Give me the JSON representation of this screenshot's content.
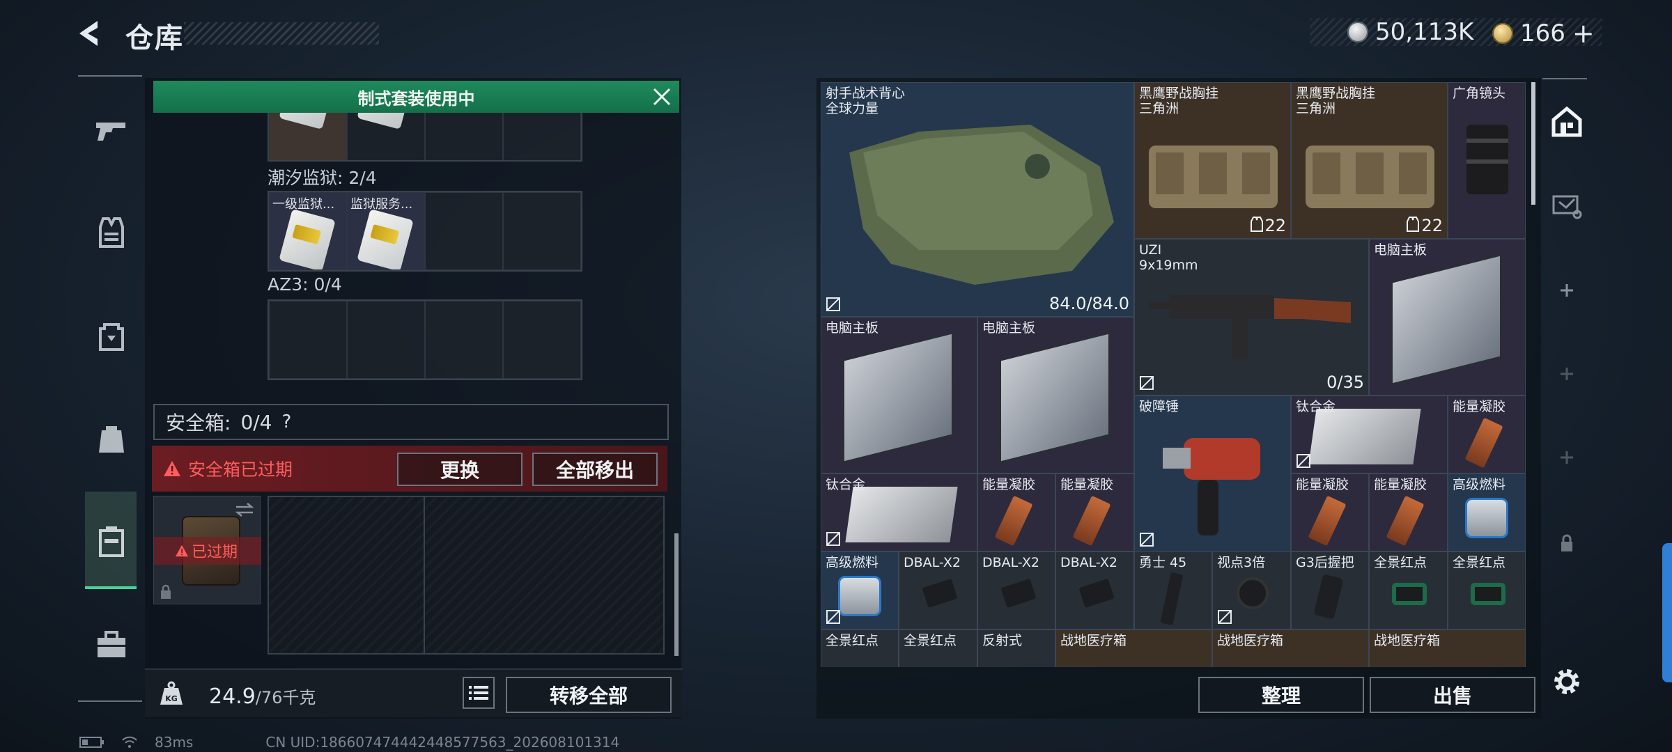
{
  "header": {
    "title": "仓库",
    "currency1": "50,113K",
    "currency2": "166",
    "currency2_add": "+"
  },
  "left_panel": {
    "banner": "制式套装使用中",
    "section1_label": "潮汐监狱: 2/4",
    "section1_slot1": "一级监狱...",
    "section1_slot2": "监狱服务...",
    "section2_label": "AZ3: 0/4",
    "safebox_label": "安全箱:",
    "safebox_count": "0/4",
    "safebox_help": "?",
    "alert_text": "安全箱已过期",
    "replace_button": "更换",
    "remove_all_button": "全部移出",
    "expired_text": "已过期",
    "weight_current": "24.9",
    "weight_max": "/76千克",
    "transfer_all_button": "转移全部"
  },
  "storage": {
    "items": [
      {
        "name": "射手战术背心\n全球力量",
        "value": "84.0/84.0"
      },
      {
        "name": "黑鹰野战胸挂\n三角洲",
        "value": "22"
      },
      {
        "name": "黑鹰野战胸挂\n三角洲",
        "value": "22"
      },
      {
        "name": "广角镜头",
        "value": ""
      },
      {
        "name": "UZI\n9x19mm",
        "value": "0/35"
      },
      {
        "name": "电脑主板",
        "value": ""
      },
      {
        "name": "电脑主板",
        "value": ""
      },
      {
        "name": "电脑主板",
        "value": ""
      },
      {
        "name": "破障锤",
        "value": ""
      },
      {
        "name": "钛合金",
        "value": ""
      },
      {
        "name": "能量凝胶",
        "value": ""
      },
      {
        "name": "钛合金",
        "value": ""
      },
      {
        "name": "能量凝胶",
        "value": ""
      },
      {
        "name": "能量凝胶",
        "value": ""
      },
      {
        "name": "能量凝胶",
        "value": ""
      },
      {
        "name": "能量凝胶",
        "value": ""
      },
      {
        "name": "高级燃料",
        "value": ""
      },
      {
        "name": "高级燃料",
        "value": ""
      },
      {
        "name": "DBAL-X2",
        "value": ""
      },
      {
        "name": "DBAL-X2",
        "value": ""
      },
      {
        "name": "DBAL-X2",
        "value": ""
      },
      {
        "name": "勇士 45",
        "value": ""
      },
      {
        "name": "视点3倍",
        "value": ""
      },
      {
        "name": "G3后握把",
        "value": ""
      },
      {
        "name": "全景红点",
        "value": ""
      },
      {
        "name": "全景红点",
        "value": ""
      },
      {
        "name": "全景红点",
        "value": ""
      },
      {
        "name": "全景红点",
        "value": ""
      },
      {
        "name": "反射式",
        "value": ""
      },
      {
        "name": "战地医疗箱",
        "value": ""
      },
      {
        "name": "战地医疗箱",
        "value": ""
      },
      {
        "name": "战地医疗箱",
        "value": ""
      }
    ]
  },
  "actions": {
    "organize_button": "整理",
    "sell_button": "出售"
  },
  "status_bar": {
    "ping": "83ms",
    "uid": "CN UID:1866074744424485775­63_202608101314"
  },
  "colors": {
    "accent_green": "#1f8a5c",
    "alert_red": "#ff5d5d",
    "active_nav": "#42d39a",
    "item_blue": "#24374d",
    "item_brown": "#3d3126",
    "item_purple": "#2d2a3d"
  }
}
